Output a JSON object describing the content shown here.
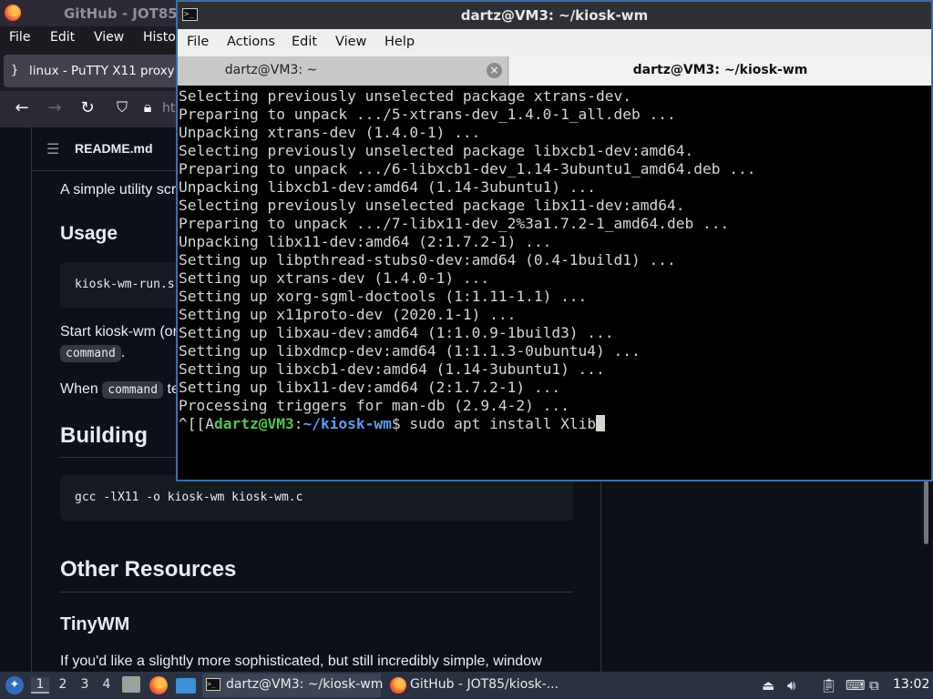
{
  "browser": {
    "window_title": "GitHub - JOT85/",
    "menu": [
      "File",
      "Edit",
      "View",
      "Histo"
    ],
    "tab_label": "linux - PuTTY X11 proxy",
    "url_partial": "ht",
    "readme": {
      "file_title": "README.md",
      "intro_text": "A simple utility scr",
      "usage_heading": "Usage",
      "usage_code": "kiosk-wm-run.s",
      "start_text": "Start kiosk-wm (or",
      "command_code_1": "command",
      "when_text": "When",
      "command_code_2": "command",
      "when_text_after": "te",
      "building_heading": "Building",
      "build_code": "gcc -lX11 -o kiosk-wm kiosk-wm.c",
      "other_heading": "Other Resources",
      "tinywm_heading": "TinyWM",
      "tinywm_text": "If you'd like a slightly more sophisticated, but still incredibly simple, window"
    }
  },
  "terminal": {
    "window_title": "dartz@VM3: ~/kiosk-wm",
    "menu": [
      "File",
      "Actions",
      "Edit",
      "View",
      "Help"
    ],
    "tabs": [
      {
        "label": "dartz@VM3: ~"
      },
      {
        "label": "dartz@VM3: ~/kiosk-wm"
      }
    ],
    "lines": [
      "Selecting previously unselected package xtrans-dev.",
      "Preparing to unpack .../5-xtrans-dev_1.4.0-1_all.deb ...",
      "Unpacking xtrans-dev (1.4.0-1) ...",
      "Selecting previously unselected package libxcb1-dev:amd64.",
      "Preparing to unpack .../6-libxcb1-dev_1.14-3ubuntu1_amd64.deb ...",
      "Unpacking libxcb1-dev:amd64 (1.14-3ubuntu1) ...",
      "Selecting previously unselected package libx11-dev:amd64.",
      "Preparing to unpack .../7-libx11-dev_2%3a1.7.2-1_amd64.deb ...",
      "Unpacking libx11-dev:amd64 (2:1.7.2-1) ...",
      "Setting up libpthread-stubs0-dev:amd64 (0.4-1build1) ...",
      "Setting up xtrans-dev (1.4.0-1) ...",
      "Setting up xorg-sgml-doctools (1:1.11-1.1) ...",
      "Setting up x11proto-dev (2020.1-1) ...",
      "Setting up libxau-dev:amd64 (1:1.0.9-1build3) ...",
      "Setting up libxdmcp-dev:amd64 (1:1.1.3-0ubuntu4) ...",
      "Setting up libxcb1-dev:amd64 (1.14-3ubuntu1) ...",
      "Setting up libx11-dev:amd64 (2:1.7.2-1) ...",
      "Processing triggers for man-db (2.9.4-2) ..."
    ],
    "prompt": {
      "prefix": "^[[A",
      "user_host": "dartz@VM3",
      "sep": ":",
      "path": "~/kiosk-wm",
      "symbol": "$ ",
      "command": "sudo apt install Xlib"
    }
  },
  "taskbar": {
    "workspaces": [
      "1",
      "2",
      "3",
      "4"
    ],
    "active_workspace": "1",
    "tasks": [
      {
        "label": "dartz@VM3: ~/kiosk-wm",
        "icon": "terminal-icon"
      },
      {
        "label": "GitHub - JOT85/kiosk-...",
        "icon": "firefox-icon"
      }
    ],
    "clock": "13:02"
  }
}
